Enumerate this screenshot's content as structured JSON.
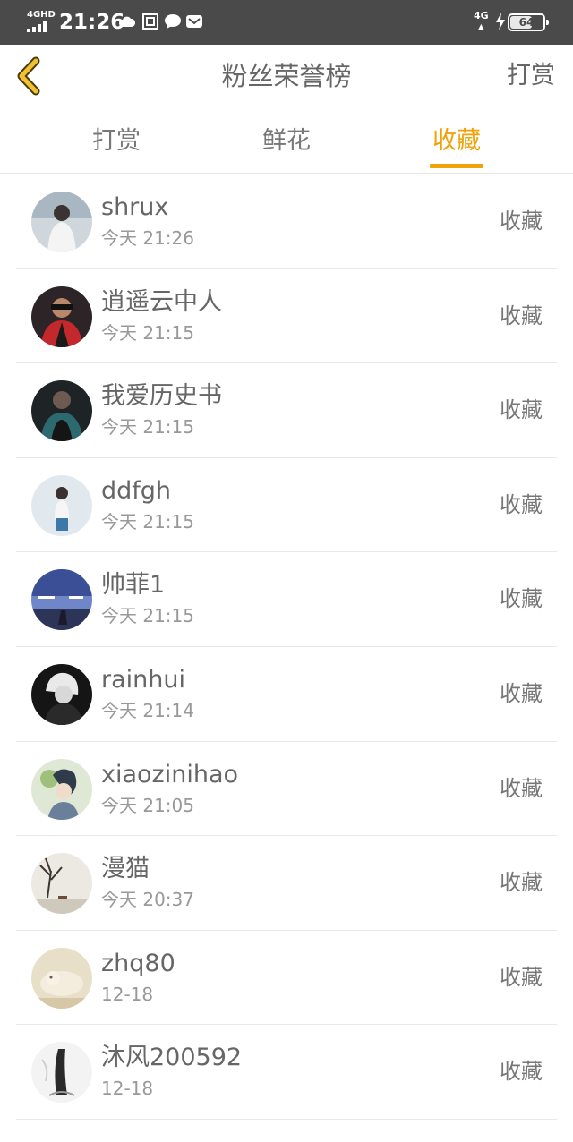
{
  "status_bar": {
    "network": "4GHD",
    "time": "21:26",
    "right_network": "4G",
    "battery": "64"
  },
  "header": {
    "title": "粉丝荣誉榜",
    "action": "打赏",
    "accent_color": "#f0a20a"
  },
  "tabs": [
    {
      "label": "打赏",
      "active": false
    },
    {
      "label": "鲜花",
      "active": false
    },
    {
      "label": "收藏",
      "active": true
    }
  ],
  "list": [
    {
      "name": "shrux",
      "time": "今天 21:26",
      "type": "收藏"
    },
    {
      "name": "逍遥云中人",
      "time": "今天 21:15",
      "type": "收藏"
    },
    {
      "name": "我爱历史书",
      "time": "今天 21:15",
      "type": "收藏"
    },
    {
      "name": "ddfgh",
      "time": "今天 21:15",
      "type": "收藏"
    },
    {
      "name": "帅菲1",
      "time": "今天 21:15",
      "type": "收藏"
    },
    {
      "name": "rainhui",
      "time": "今天 21:14",
      "type": "收藏"
    },
    {
      "name": "xiaozinihao",
      "time": "今天 21:05",
      "type": "收藏"
    },
    {
      "name": "漫猫",
      "time": "今天 20:37",
      "type": "收藏"
    },
    {
      "name": "zhq80",
      "time": "12-18",
      "type": "收藏"
    },
    {
      "name": "沐风200592",
      "time": "12-18",
      "type": "收藏"
    }
  ]
}
